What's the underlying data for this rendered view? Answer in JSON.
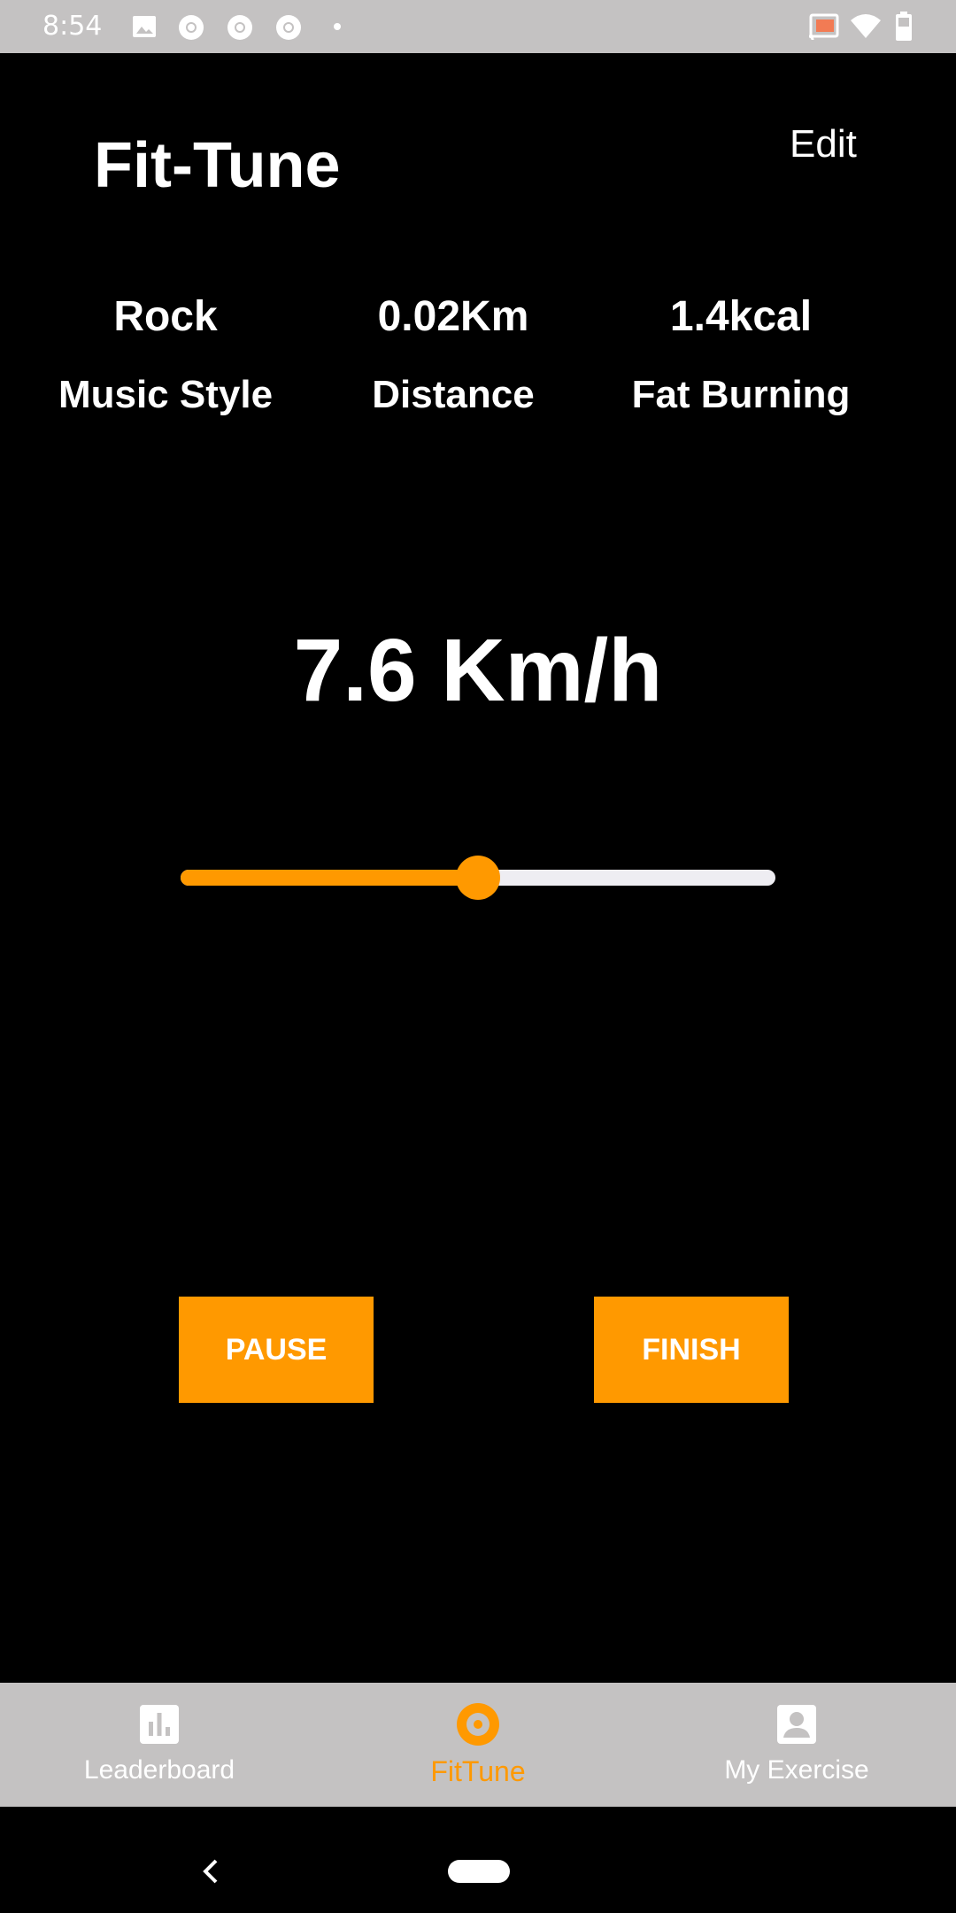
{
  "status_bar": {
    "time": "8:54"
  },
  "header": {
    "title": "Fit-Tune",
    "edit_label": "Edit"
  },
  "stats": [
    {
      "value": "Rock",
      "label": "Music Style"
    },
    {
      "value": "0.02Km",
      "label": "Distance"
    },
    {
      "value": "1.4kcal",
      "label": "Fat Burning"
    }
  ],
  "speed": {
    "text": "7.6 Km/h"
  },
  "slider": {
    "level": 0.5
  },
  "buttons": {
    "pause": "PAUSE",
    "finish": "FINISH"
  },
  "nav": {
    "items": [
      {
        "label": "Leaderboard",
        "icon": "bar-chart-icon"
      },
      {
        "label": "FitTune",
        "icon": "disc-icon"
      },
      {
        "label": "My Exercise",
        "icon": "account-box-icon"
      }
    ],
    "active_index": 1
  },
  "colors": {
    "accent": "#ff9900",
    "nav_background": "#c4c2c2",
    "background": "#000000"
  }
}
